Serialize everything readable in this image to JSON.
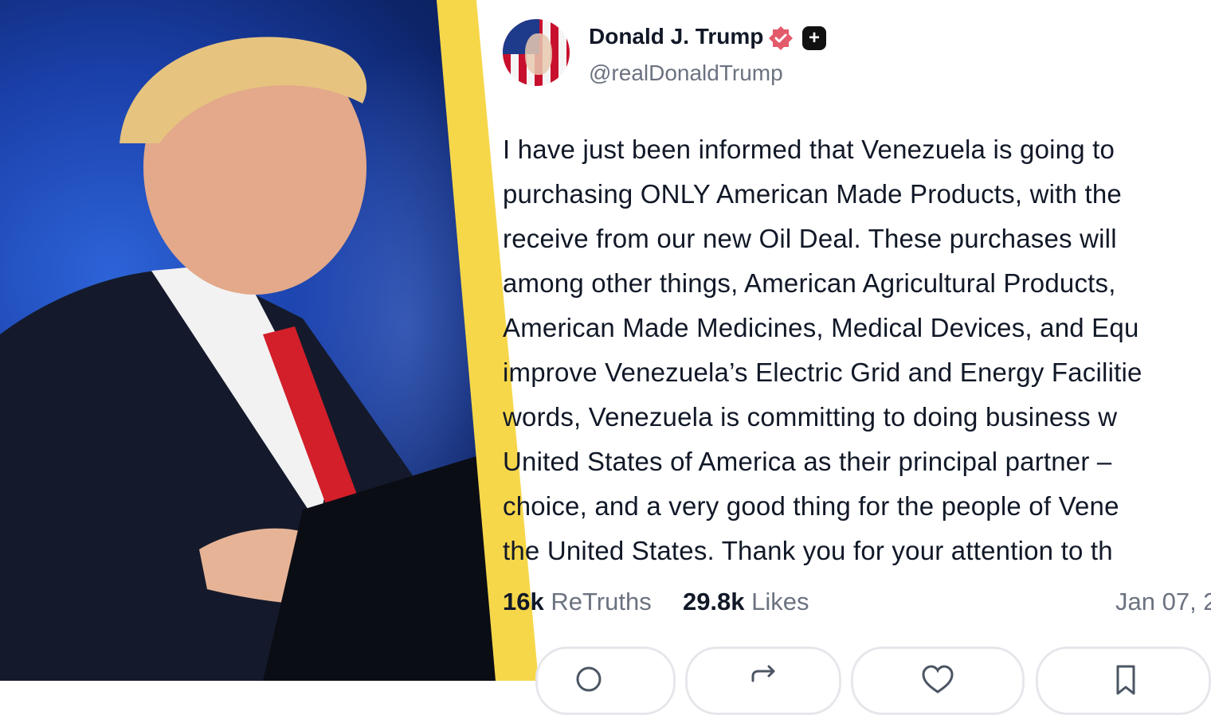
{
  "post": {
    "author_name": "Donald J. Trump",
    "handle": "@realDonaldTrump",
    "badge_plus": "+",
    "text_lines": [
      "I have just been informed that Venezuela is going to",
      "purchasing ONLY American Made Products, with the",
      "receive from our new Oil Deal. These purchases will",
      "among other things, American Agricultural Products,",
      "American Made Medicines, Medical Devices, and Equ",
      "improve Venezuela’s Electric Grid and Energy Facilitie",
      "words, Venezuela is committing to doing business w",
      "United States of America as their principal partner –",
      "choice, and a very good thing for the people of Vene",
      "the United States. Thank you for your attention to th"
    ],
    "retruths_count": "16k",
    "retruths_label": "ReTruths",
    "likes_count": "29.8k",
    "likes_label": "Likes",
    "date": "Jan 07, 2"
  },
  "icons": {
    "verified": "verified-badge-icon",
    "plus": "truth-plus-icon",
    "reply": "reply-icon",
    "retruth": "retruth-icon",
    "like": "like-icon",
    "bookmark": "bookmark-icon"
  },
  "colors": {
    "accent_yellow": "#f6d74a",
    "verified_pink": "#e35b6b",
    "text": "#111827",
    "muted": "#6b7280"
  }
}
